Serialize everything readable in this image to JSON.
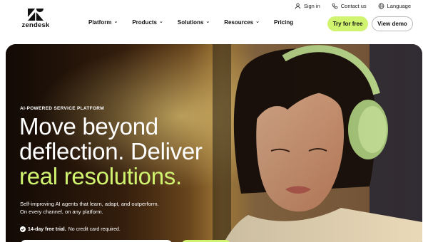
{
  "utility": {
    "sign_in": "Sign in",
    "contact": "Contact us",
    "language": "Language"
  },
  "brand": {
    "wordmark": "zendesk"
  },
  "nav": {
    "items": [
      {
        "label": "Platform",
        "has_dropdown": true
      },
      {
        "label": "Products",
        "has_dropdown": true
      },
      {
        "label": "Solutions",
        "has_dropdown": true
      },
      {
        "label": "Resources",
        "has_dropdown": true
      },
      {
        "label": "Pricing",
        "has_dropdown": false
      }
    ],
    "try_free": "Try for free",
    "view_demo": "View demo"
  },
  "hero": {
    "eyebrow": "AI-POWERED SERVICE PLATFORM",
    "headline_line1": "Move beyond",
    "headline_line2": "deflection. Deliver",
    "headline_accent": "real resolutions.",
    "subtext_line1": "Self-improving AI agents that learn, adapt, and outperform.",
    "subtext_line2": "On every channel, on any platform.",
    "trial_bold": "14-day free trial.",
    "trial_rest": "No credit card required."
  },
  "colors": {
    "accent": "#d1f470",
    "text": "#111111",
    "hero_dark": "#2a170b"
  },
  "icons": [
    "user-icon",
    "phone-icon",
    "globe-icon",
    "zendesk-logo-icon",
    "chevron-down-icon",
    "check-circle-icon"
  ]
}
